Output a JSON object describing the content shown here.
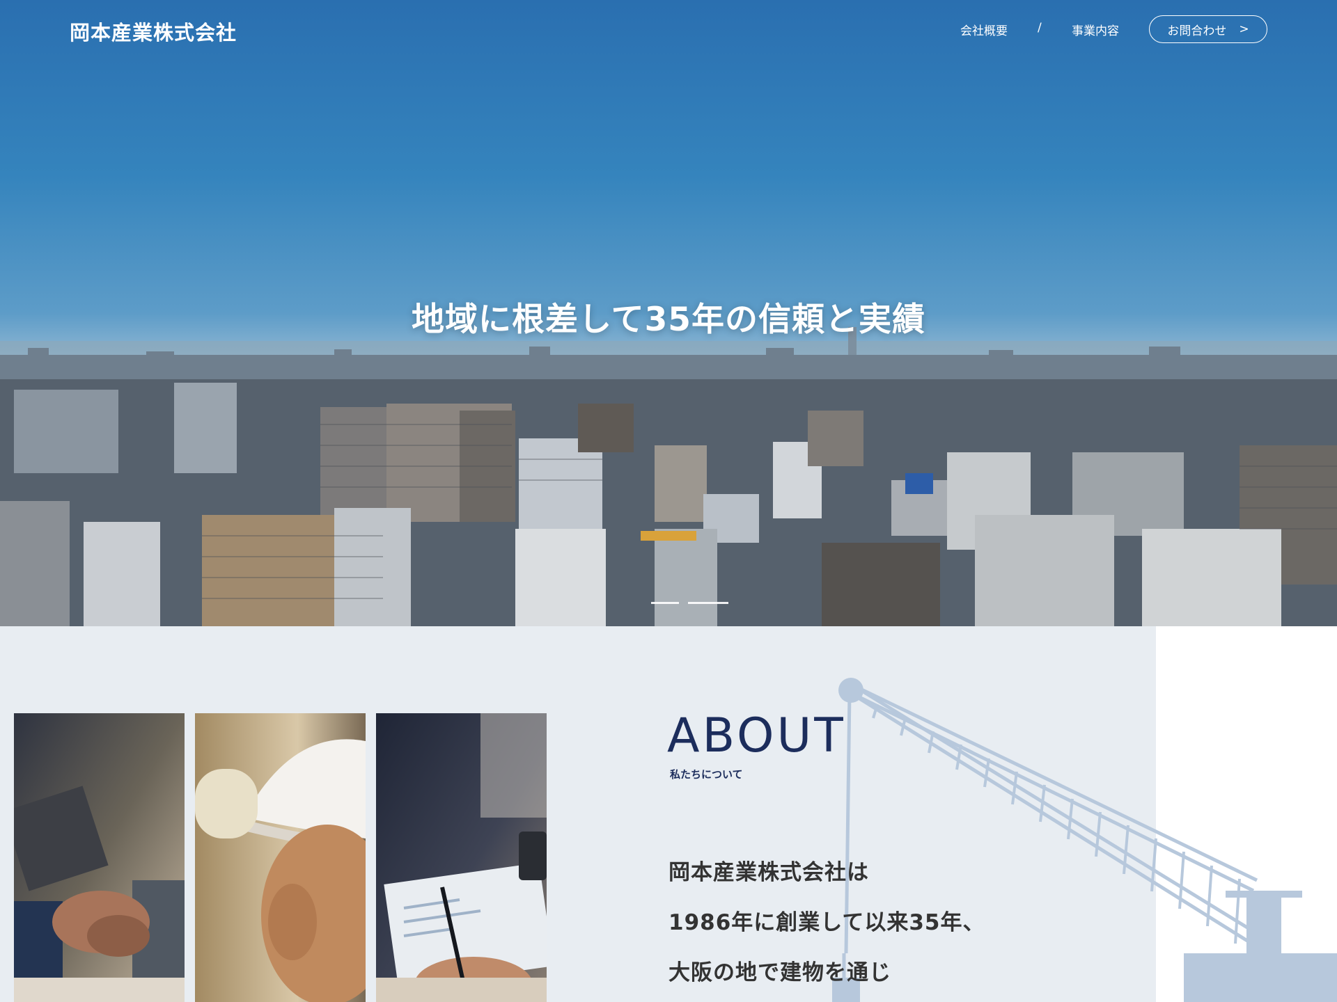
{
  "header": {
    "logo": "岡本産業株式会社",
    "nav": {
      "about": "会社概要",
      "separator": "/",
      "services": "事業内容"
    },
    "contact_button": "お問合わせ",
    "contact_arrow": ">"
  },
  "hero": {
    "catchphrase": "地域に根差して35年の信頼と実績",
    "slide_indicators": 2
  },
  "about": {
    "title": "ABOUT",
    "subtitle": "私たちについて",
    "lines": [
      "岡本産業株式会社は",
      "1986年に創業して以来35年、",
      "大阪の地で建物を通じ"
    ],
    "photos": [
      "handshake-photo",
      "worker-hardhat-photo",
      "document-signing-photo"
    ]
  },
  "colors": {
    "primary": "#1c2d5c",
    "about_bg": "#e8edf2",
    "crane": "#b7c8dc"
  }
}
